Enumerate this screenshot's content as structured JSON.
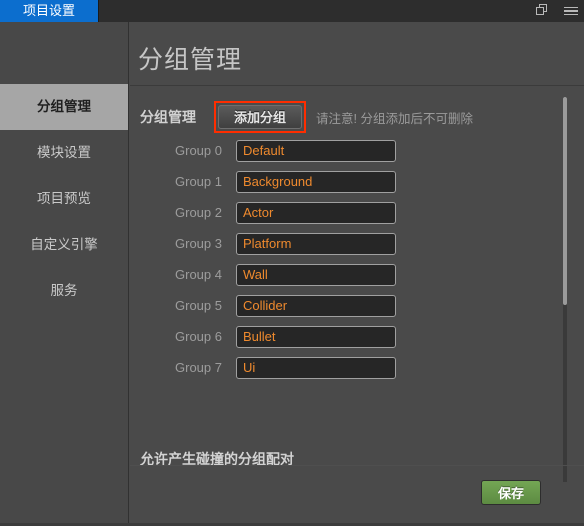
{
  "window": {
    "tab_label": "项目设置",
    "restore_icon": "restore-window-icon",
    "menu_icon": "hamburger-menu-icon"
  },
  "sidebar": {
    "items": [
      {
        "label": "分组管理",
        "active": true
      },
      {
        "label": "模块设置",
        "active": false
      },
      {
        "label": "项目预览",
        "active": false
      },
      {
        "label": "自定义引擎",
        "active": false
      },
      {
        "label": "服务",
        "active": false
      }
    ]
  },
  "page": {
    "title": "分组管理",
    "section_label": "分组管理",
    "add_button": "添加分组",
    "note": "请注意! 分组添加后不可删除",
    "collision_heading": "允许产生碰撞的分组配对",
    "save_button": "保存"
  },
  "groups": [
    {
      "name": "Group 0",
      "value": "Default"
    },
    {
      "name": "Group 1",
      "value": "Background"
    },
    {
      "name": "Group 2",
      "value": "Actor"
    },
    {
      "name": "Group 3",
      "value": "Platform"
    },
    {
      "name": "Group 4",
      "value": "Wall"
    },
    {
      "name": "Group 5",
      "value": "Collider"
    },
    {
      "name": "Group 6",
      "value": "Bullet"
    },
    {
      "name": "Group 7",
      "value": "Ui"
    }
  ],
  "colors": {
    "accent_tab": "#0c6ece",
    "highlight_border": "#ff2d00",
    "input_text": "#ef8a2e",
    "save_button": "#74a654",
    "background": "#4a4a4a"
  }
}
